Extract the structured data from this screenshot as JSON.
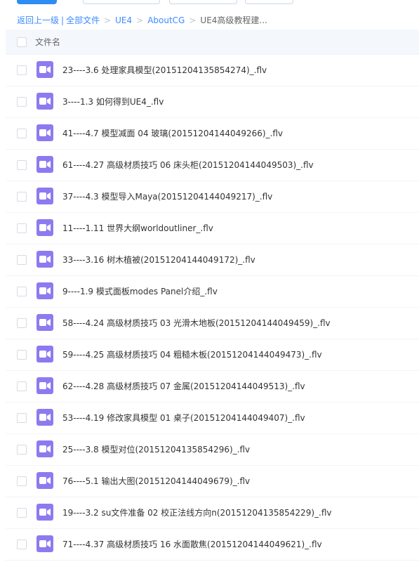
{
  "breadcrumb": {
    "back": "返回上一级",
    "all_files": "全部文件",
    "crumbs": [
      "UE4",
      "AboutCG"
    ],
    "current": "UE4高级教程建..."
  },
  "list_header": {
    "column_name": "文件名"
  },
  "files": [
    {
      "name": "23----3.6 处理家具模型(20151204135854274)_.flv",
      "icon": "video-file-icon"
    },
    {
      "name": "3----1.3 如何得到UE4_.flv",
      "icon": "video-file-icon"
    },
    {
      "name": "41----4.7 模型减面 04 玻璃(20151204144049266)_.flv",
      "icon": "video-file-icon"
    },
    {
      "name": "61----4.27 高级材质技巧 06 床头柜(20151204144049503)_.flv",
      "icon": "video-file-icon"
    },
    {
      "name": "37----4.3 模型导入Maya(20151204144049217)_.flv",
      "icon": "video-file-icon"
    },
    {
      "name": "11----1.11 世界大纲worldoutliner_.flv",
      "icon": "video-file-icon"
    },
    {
      "name": "33----3.16 树木植被(20151204144049172)_.flv",
      "icon": "video-file-icon"
    },
    {
      "name": "9----1.9 模式面板modes Panel介绍_.flv",
      "icon": "video-file-icon"
    },
    {
      "name": "58----4.24 高级材质技巧 03 光滑木地板(20151204144049459)_.flv",
      "icon": "video-file-icon"
    },
    {
      "name": "59----4.25 高级材质技巧 04 粗糙木板(20151204144049473)_.flv",
      "icon": "video-file-icon"
    },
    {
      "name": "62----4.28 高级材质技巧 07 金属(20151204144049513)_.flv",
      "icon": "video-file-icon"
    },
    {
      "name": "53----4.19 修改家具模型 01 桌子(20151204144049407)_.flv",
      "icon": "video-file-icon"
    },
    {
      "name": "25----3.8 模型对位(20151204135854296)_.flv",
      "icon": "video-file-icon"
    },
    {
      "name": "76----5.1 输出大图(20151204144049679)_.flv",
      "icon": "video-file-icon"
    },
    {
      "name": "19----3.2 su文件准备 02 校正法线方向n(20151204135854229)_.flv",
      "icon": "video-file-icon"
    },
    {
      "name": "71----4.37 高级材质技巧 16 水面散焦(20151204144049621)_.flv",
      "icon": "video-file-icon"
    }
  ],
  "colors": {
    "accent": "#2f8cf3",
    "link": "#3b8cff",
    "video_icon": "#8e7af0",
    "header_bg": "#f4f8fd"
  }
}
